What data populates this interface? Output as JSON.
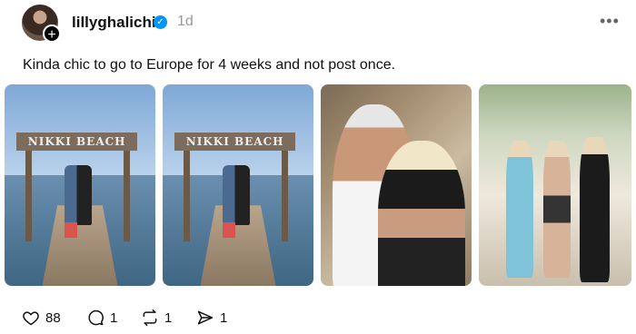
{
  "post": {
    "username": "lillyghalichi",
    "time": "1d",
    "caption": "Kinda chic to go to Europe for 4 weeks and not post once.",
    "more": "•••",
    "photos": [
      {
        "sign": "NIKKI BEACH"
      },
      {
        "sign": "NIKKI BEACH"
      },
      {},
      {}
    ],
    "actions": {
      "likes": "88",
      "replies": "1",
      "reposts": "1",
      "shares": "1"
    }
  },
  "colors": {
    "verified": "#0095f6",
    "text": "#111111",
    "muted": "#999999"
  }
}
